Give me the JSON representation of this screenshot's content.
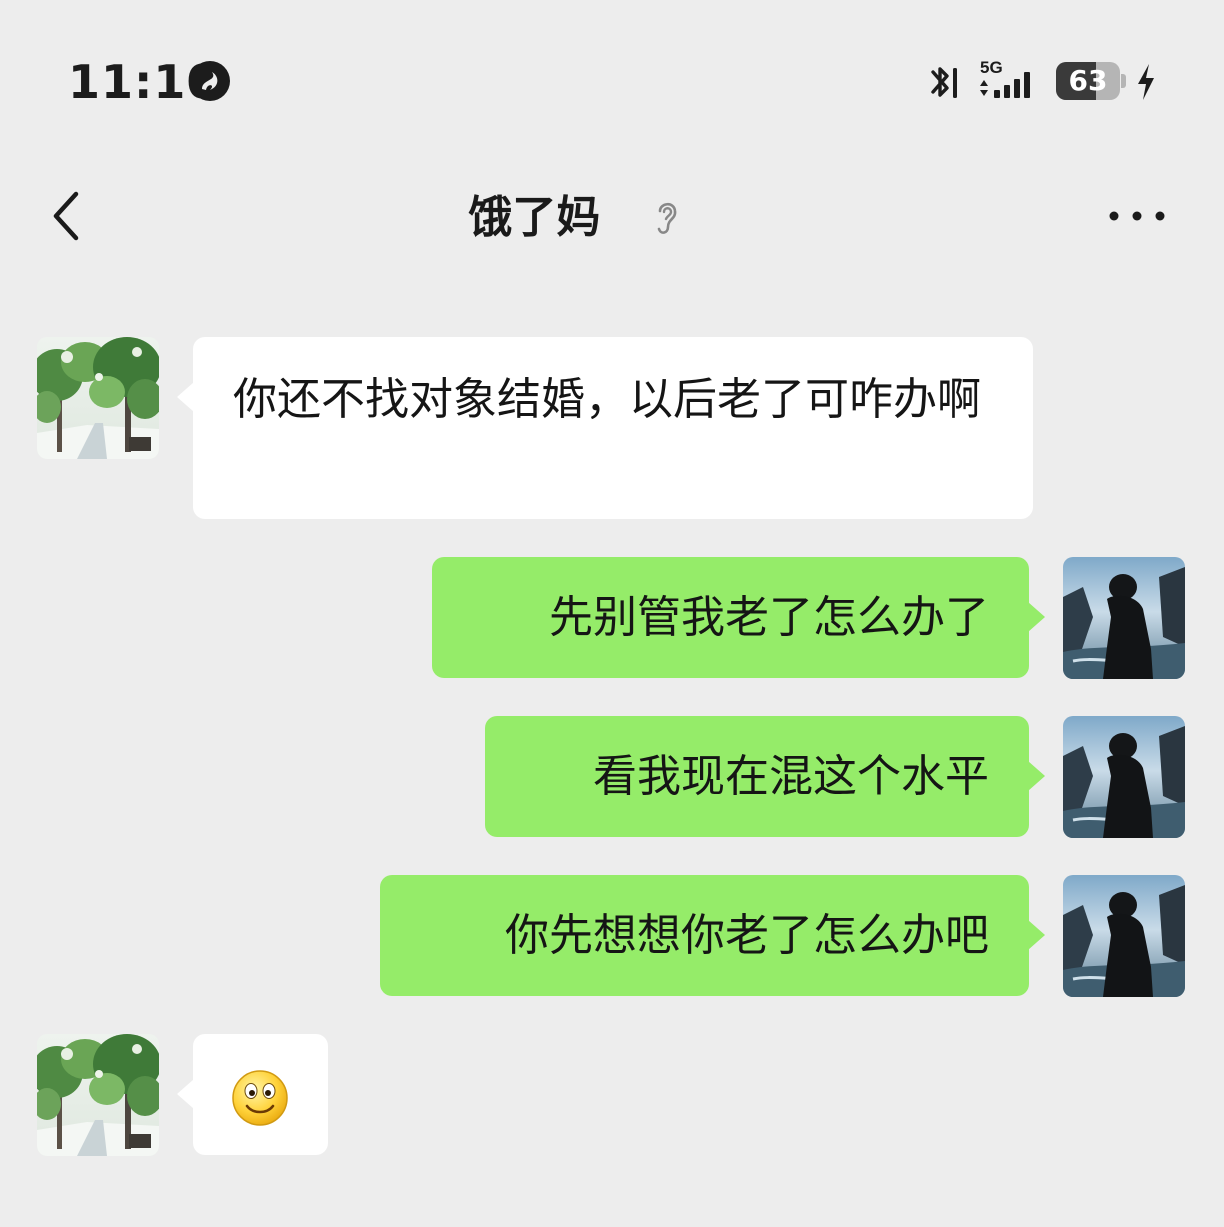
{
  "status_bar": {
    "time": "11:10",
    "network_label": "5G",
    "battery_level": "63",
    "battery_fraction": 0.63,
    "icons": [
      "app-notification-icon",
      "bluetooth-icon",
      "signal-icon",
      "charging-icon"
    ]
  },
  "header": {
    "title": "饿了妈",
    "icons": [
      "back-icon",
      "ear-icon",
      "more-icon"
    ]
  },
  "colors": {
    "background": "#ededed",
    "incoming_bubble": "#ffffff",
    "outgoing_bubble": "#95ec69",
    "text": "#151515"
  },
  "messages": [
    {
      "sender": "other",
      "text": "你还不找对象结婚，以后老了可咋办啊"
    },
    {
      "sender": "me",
      "text": "先别管我老了怎么办了"
    },
    {
      "sender": "me",
      "text": "看我现在混这个水平"
    },
    {
      "sender": "me",
      "text": "你先想想你老了怎么办吧"
    },
    {
      "sender": "other",
      "emoji": "smiley-icon"
    }
  ]
}
